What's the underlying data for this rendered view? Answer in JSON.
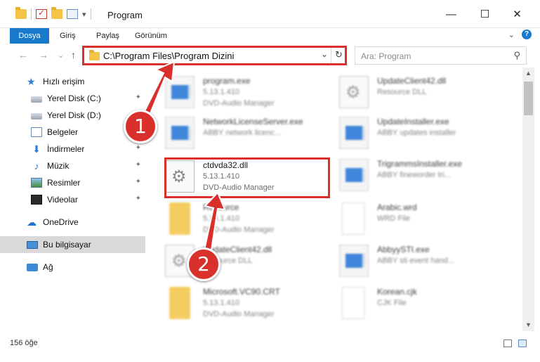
{
  "window": {
    "title": "Program",
    "minimize": "—",
    "maximize": "☐",
    "close": "✕"
  },
  "ribbon": {
    "tabs": [
      "Dosya",
      "Giriş",
      "Paylaş",
      "Görünüm"
    ],
    "expand_icon": "chevron-down-icon",
    "help_label": "?"
  },
  "nav": {
    "back": "←",
    "forward": "→",
    "recent": "⌄",
    "up": "↑"
  },
  "address": {
    "path": "C:\\Program Files\\Program Dizini",
    "dropdown": "⌄",
    "refresh": "↻"
  },
  "search": {
    "placeholder": "Ara: Program",
    "icon": "⚲"
  },
  "sidebar": {
    "items": [
      {
        "label": "Hızlı erişim",
        "icon": "star-icon",
        "pinned": false
      },
      {
        "label": "Yerel Disk (C:)",
        "icon": "drive-icon",
        "pinned": true
      },
      {
        "label": "Yerel Disk (D:)",
        "icon": "drive-icon",
        "pinned": false
      },
      {
        "label": "Belgeler",
        "icon": "documents-icon",
        "pinned": true
      },
      {
        "label": "İndirmeler",
        "icon": "downloads-icon",
        "pinned": true
      },
      {
        "label": "Müzik",
        "icon": "music-icon",
        "pinned": true
      },
      {
        "label": "Resimler",
        "icon": "pictures-icon",
        "pinned": true
      },
      {
        "label": "Videolar",
        "icon": "videos-icon",
        "pinned": true
      },
      {
        "label": "OneDrive",
        "icon": "onedrive-icon",
        "pinned": false
      },
      {
        "label": "Bu bilgisayar",
        "icon": "computer-icon",
        "pinned": false
      },
      {
        "label": "Ağ",
        "icon": "network-icon",
        "pinned": false
      }
    ],
    "pin_glyph": "📌"
  },
  "files": [
    {
      "name": "program.exe",
      "line1": "5.13.1.410",
      "line2": "DVD-Audio Manager",
      "type": "exe"
    },
    {
      "name": "UpdateClient42.dll",
      "line1": "Resource DLL",
      "line2": "",
      "type": "dll"
    },
    {
      "name": "NetworkLicenseServer.exe",
      "line1": "ABBY network licenc...",
      "line2": "",
      "type": "exe"
    },
    {
      "name": "UpdateInstaller.exe",
      "line1": "ABBY updates installer",
      "line2": "",
      "type": "exe"
    },
    {
      "name": "ctdvda32.dll",
      "line1": "5.13.1.410",
      "line2": "DVD-Audio Manager",
      "type": "dll"
    },
    {
      "name": "TrigrammsInstaller.exe",
      "line1": "ABBY fineworder tri...",
      "line2": "",
      "type": "exe"
    },
    {
      "name": "Resource",
      "line1": "5.13.1.410",
      "line2": "DVD-Audio Manager",
      "type": "folder"
    },
    {
      "name": "Arabic.wrd",
      "line1": "WRD File",
      "line2": "",
      "type": "blank"
    },
    {
      "name": "UpdateClient42.dll",
      "line1": "Resource DLL",
      "line2": "",
      "type": "dll"
    },
    {
      "name": "AbbyySTI.exe",
      "line1": "ABBY sti event hand...",
      "line2": "",
      "type": "exe"
    },
    {
      "name": "Microsoft.VC90.CRT",
      "line1": "5.13.1.410",
      "line2": "DVD-Audio Manager",
      "type": "folder"
    },
    {
      "name": "Korean.cjk",
      "line1": "CJK File",
      "line2": "",
      "type": "blank"
    }
  ],
  "status": {
    "count": "156 öğe"
  },
  "annotations": {
    "badge1": "1",
    "badge2": "2",
    "highlight_color": "#d9302c"
  },
  "colors": {
    "accent": "#1979ca",
    "annotation_red": "#d9302c",
    "selected_bg": "#d9d9d9"
  }
}
